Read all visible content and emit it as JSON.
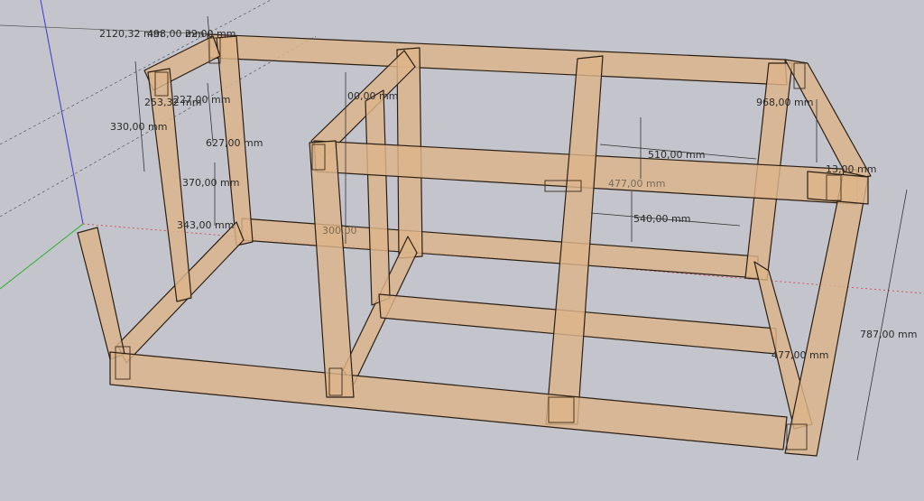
{
  "dimensions": {
    "overall_length": "2120,32 mm",
    "top_length": "498,00 mm",
    "top_small": "22,00 mm",
    "left_tab": "253,32 mm",
    "left_tab2": "227,00 mm",
    "left_height": "330,00 mm",
    "post_a": "627,00 mm",
    "post_b": "370,00 mm",
    "post_c": "343,00 mm",
    "inner_post": "00,00 mm",
    "inner_height": "300,00",
    "right_width": "968,00 mm",
    "right_small": "13,00 mm",
    "mid_span": "510,00 mm",
    "mid_depth": "477,00 mm",
    "lower_span": "540,00 mm",
    "right_lower": "477,00 mm",
    "total_height": "787,00 mm"
  },
  "colors": {
    "background": "#c4c4cc",
    "wood": "#ddb48a",
    "wood_shade": "#c99a6b",
    "edge": "#2b1f14"
  }
}
